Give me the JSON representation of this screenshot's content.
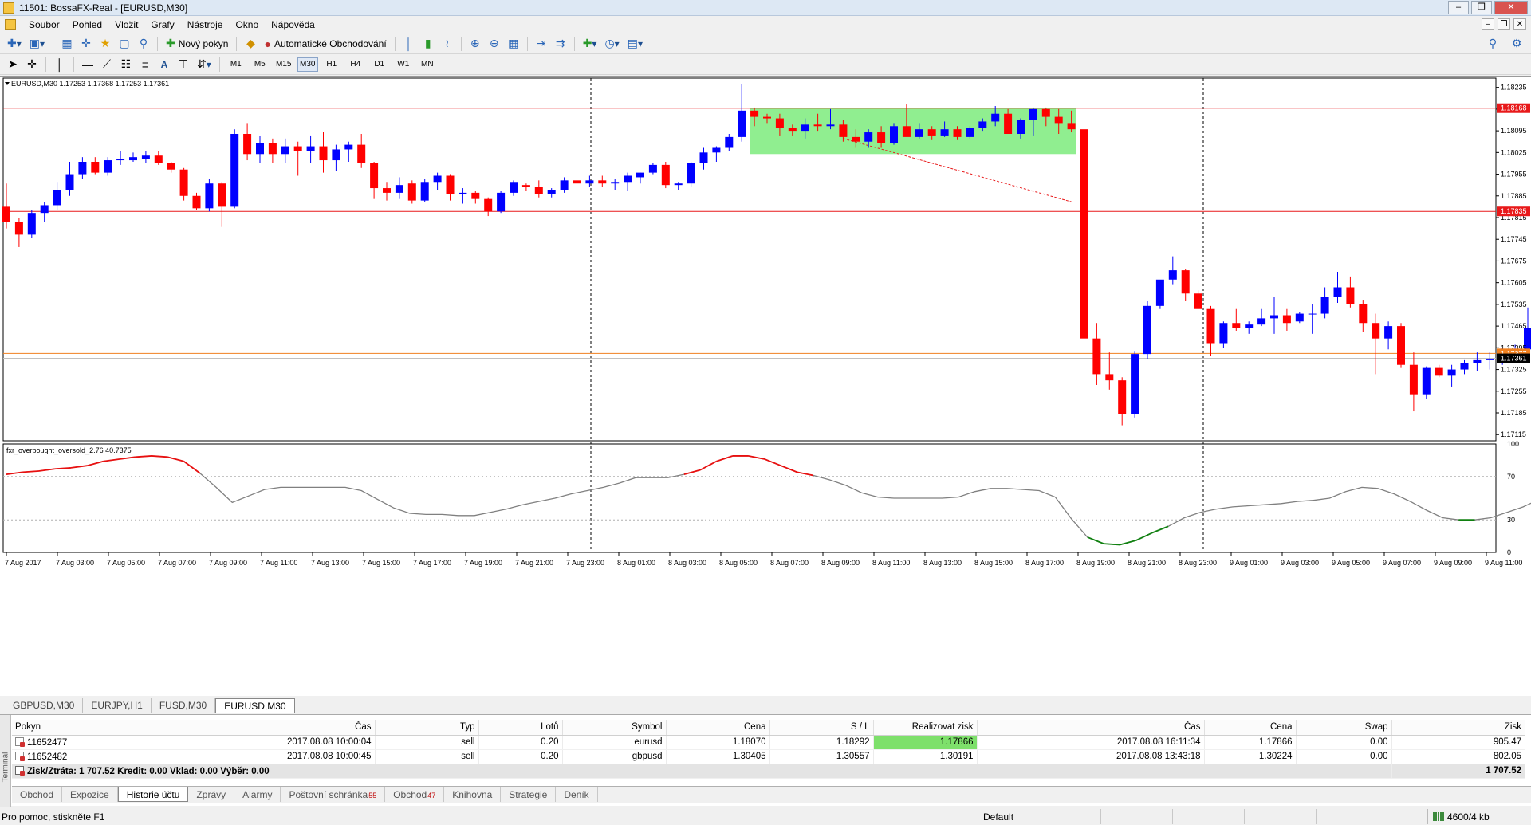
{
  "window": {
    "title": "11501: BossaFX-Real - [EURUSD,M30]"
  },
  "menu": [
    "Soubor",
    "Pohled",
    "Vložit",
    "Grafy",
    "Nástroje",
    "Okno",
    "Nápověda"
  ],
  "toolbar": {
    "new_order": "Nový pokyn",
    "auto_trading": "Automatické Obchodování"
  },
  "timeframes": [
    "M1",
    "M5",
    "M15",
    "M30",
    "H1",
    "H4",
    "D1",
    "W1",
    "MN"
  ],
  "active_timeframe": "M30",
  "chart": {
    "info": "EURUSD,M30  1.17253 1.17368 1.17253 1.17361",
    "indicator_label": "fxr_overbought_oversold_2.76 40.7375",
    "price_ticks": [
      "1.18235",
      "1.18165",
      "1.18095",
      "1.18025",
      "1.17955",
      "1.17885",
      "1.17815",
      "1.17745",
      "1.17675",
      "1.17605",
      "1.17535",
      "1.17465",
      "1.17395",
      "1.17325",
      "1.17255",
      "1.17185",
      "1.17115"
    ],
    "price_labels": {
      "upper_line": "1.18168",
      "lower_line": "1.17835",
      "orange_line": "1.17377",
      "bid": "1.17361"
    },
    "indicator_ticks": [
      "100",
      "70",
      "30",
      "0"
    ],
    "time_ticks": [
      "7 Aug 2017",
      "7 Aug 03:00",
      "7 Aug 05:00",
      "7 Aug 07:00",
      "7 Aug 09:00",
      "7 Aug 11:00",
      "7 Aug 13:00",
      "7 Aug 15:00",
      "7 Aug 17:00",
      "7 Aug 19:00",
      "7 Aug 21:00",
      "7 Aug 23:00",
      "8 Aug 01:00",
      "8 Aug 03:00",
      "8 Aug 05:00",
      "8 Aug 07:00",
      "8 Aug 09:00",
      "8 Aug 11:00",
      "8 Aug 13:00",
      "8 Aug 15:00",
      "8 Aug 17:00",
      "8 Aug 19:00",
      "8 Aug 21:00",
      "8 Aug 23:00",
      "9 Aug 01:00",
      "9 Aug 03:00",
      "9 Aug 05:00",
      "9 Aug 07:00",
      "9 Aug 09:00",
      "9 Aug 11:00"
    ],
    "colors": {
      "bull": "#0000ff",
      "bear": "#ff0000",
      "box": "#90ee90",
      "hline": "#e8191a",
      "orange": "#f08020",
      "osc": "#808080",
      "overbought": "#e81010",
      "oversold": "#108010"
    }
  },
  "chart_data": {
    "type": "candlestick",
    "symbol": "EURUSD",
    "timeframe": "M30",
    "ylim": [
      1.17095,
      1.18265
    ],
    "candles": [
      [
        1.1785,
        1.17925,
        1.1778,
        1.178
      ],
      [
        1.178,
        1.17815,
        1.1772,
        1.1776
      ],
      [
        1.1776,
        1.1784,
        1.1775,
        1.1783
      ],
      [
        1.1783,
        1.17865,
        1.178,
        1.17855
      ],
      [
        1.17855,
        1.1793,
        1.1784,
        1.17905
      ],
      [
        1.17905,
        1.17995,
        1.17885,
        1.17955
      ],
      [
        1.17955,
        1.1801,
        1.1794,
        1.17995
      ],
      [
        1.17995,
        1.1801,
        1.17955,
        1.1796
      ],
      [
        1.1796,
        1.1801,
        1.1795,
        1.18
      ],
      [
        1.18,
        1.1803,
        1.17985,
        1.18005
      ],
      [
        1.18,
        1.18025,
        1.17995,
        1.1801
      ],
      [
        1.18005,
        1.1803,
        1.1799,
        1.18015
      ],
      [
        1.18015,
        1.1803,
        1.17985,
        1.1799
      ],
      [
        1.1799,
        1.17995,
        1.1796,
        1.1797
      ],
      [
        1.1797,
        1.17975,
        1.1787,
        1.17885
      ],
      [
        1.17885,
        1.17895,
        1.1784,
        1.17845
      ],
      [
        1.17845,
        1.1794,
        1.17835,
        1.17925
      ],
      [
        1.17925,
        1.1793,
        1.17785,
        1.1785
      ],
      [
        1.1785,
        1.181,
        1.17845,
        1.18085
      ],
      [
        1.18085,
        1.1812,
        1.18,
        1.1802
      ],
      [
        1.1802,
        1.1808,
        1.1799,
        1.18055
      ],
      [
        1.18055,
        1.1807,
        1.1799,
        1.1802
      ],
      [
        1.1802,
        1.1807,
        1.1799,
        1.18045
      ],
      [
        1.18045,
        1.1806,
        1.1795,
        1.1803
      ],
      [
        1.1803,
        1.1808,
        1.1799,
        1.18045
      ],
      [
        1.18045,
        1.1809,
        1.1796,
        1.18
      ],
      [
        1.18,
        1.1805,
        1.17965,
        1.18035
      ],
      [
        1.18035,
        1.1806,
        1.17995,
        1.1805
      ],
      [
        1.1805,
        1.18085,
        1.17975,
        1.1799
      ],
      [
        1.1799,
        1.17995,
        1.17875,
        1.1791
      ],
      [
        1.1791,
        1.1793,
        1.1787,
        1.17895
      ],
      [
        1.17895,
        1.17945,
        1.17875,
        1.1792
      ],
      [
        1.17925,
        1.17935,
        1.1786,
        1.1787
      ],
      [
        1.1787,
        1.1794,
        1.17865,
        1.1793
      ],
      [
        1.1793,
        1.1796,
        1.17905,
        1.1795
      ],
      [
        1.1795,
        1.17955,
        1.1787,
        1.1789
      ],
      [
        1.1789,
        1.1791,
        1.1786,
        1.17895
      ],
      [
        1.17895,
        1.179,
        1.1786,
        1.17875
      ],
      [
        1.17875,
        1.1788,
        1.1782,
        1.17835
      ],
      [
        1.17835,
        1.179,
        1.1783,
        1.17895
      ],
      [
        1.17895,
        1.17935,
        1.17885,
        1.1793
      ],
      [
        1.1792,
        1.17925,
        1.179,
        1.17915
      ],
      [
        1.17915,
        1.17935,
        1.1788,
        1.1789
      ],
      [
        1.1789,
        1.1791,
        1.1788,
        1.17905
      ],
      [
        1.17905,
        1.17945,
        1.17895,
        1.17935
      ],
      [
        1.17935,
        1.17955,
        1.17905,
        1.17925
      ],
      [
        1.17925,
        1.1795,
        1.17915,
        1.17935
      ],
      [
        1.17935,
        1.1795,
        1.17915,
        1.17925
      ],
      [
        1.17925,
        1.1794,
        1.17905,
        1.1793
      ],
      [
        1.1793,
        1.1796,
        1.179,
        1.1795
      ],
      [
        1.17945,
        1.1796,
        1.17925,
        1.1796
      ],
      [
        1.1796,
        1.1799,
        1.17955,
        1.17985
      ],
      [
        1.17985,
        1.17995,
        1.1791,
        1.1792
      ],
      [
        1.1792,
        1.1793,
        1.17905,
        1.17925
      ],
      [
        1.17925,
        1.17995,
        1.17915,
        1.1799
      ],
      [
        1.1799,
        1.1804,
        1.1797,
        1.18025
      ],
      [
        1.18025,
        1.18045,
        1.17995,
        1.1804
      ],
      [
        1.1804,
        1.18085,
        1.1803,
        1.18075
      ],
      [
        1.18075,
        1.18245,
        1.1806,
        1.1816
      ],
      [
        1.1816,
        1.1817,
        1.1811,
        1.1814
      ],
      [
        1.1814,
        1.1815,
        1.1812,
        1.18135
      ],
      [
        1.18135,
        1.1815,
        1.1808,
        1.18105
      ],
      [
        1.18105,
        1.18115,
        1.1808,
        1.18095
      ],
      [
        1.18095,
        1.18135,
        1.1807,
        1.18115
      ],
      [
        1.18115,
        1.1815,
        1.18095,
        1.1811
      ],
      [
        1.1811,
        1.18165,
        1.181,
        1.18115
      ],
      [
        1.18115,
        1.1813,
        1.1806,
        1.18075
      ],
      [
        1.18075,
        1.181,
        1.1804,
        1.1806
      ],
      [
        1.1806,
        1.181,
        1.1804,
        1.1809
      ],
      [
        1.1809,
        1.1811,
        1.1804,
        1.18055
      ],
      [
        1.18055,
        1.1812,
        1.1805,
        1.1811
      ],
      [
        1.1811,
        1.1818,
        1.18085,
        1.18075
      ],
      [
        1.18075,
        1.1812,
        1.1807,
        1.181
      ],
      [
        1.181,
        1.1811,
        1.18065,
        1.1808
      ],
      [
        1.1808,
        1.18125,
        1.18075,
        1.181
      ],
      [
        1.181,
        1.1811,
        1.18065,
        1.18075
      ],
      [
        1.18075,
        1.1811,
        1.1807,
        1.18105
      ],
      [
        1.18105,
        1.18135,
        1.18095,
        1.18125
      ],
      [
        1.18125,
        1.18175,
        1.1811,
        1.1815
      ],
      [
        1.1815,
        1.18165,
        1.1809,
        1.18085
      ],
      [
        1.18085,
        1.18135,
        1.1807,
        1.1813
      ],
      [
        1.1813,
        1.1817,
        1.1808,
        1.18165
      ],
      [
        1.18165,
        1.1817,
        1.1811,
        1.1814
      ],
      [
        1.1814,
        1.18165,
        1.18085,
        1.1812
      ],
      [
        1.1812,
        1.1816,
        1.1809,
        1.181
      ],
      [
        1.181,
        1.1811,
        1.174,
        1.17425
      ],
      [
        1.17425,
        1.17475,
        1.17275,
        1.1731
      ],
      [
        1.1731,
        1.1738,
        1.1726,
        1.1729
      ],
      [
        1.1729,
        1.173,
        1.17145,
        1.1718
      ],
      [
        1.1718,
        1.17385,
        1.1717,
        1.17375
      ],
      [
        1.17375,
        1.17545,
        1.1736,
        1.1753
      ],
      [
        1.1753,
        1.1761,
        1.1752,
        1.17615
      ],
      [
        1.17615,
        1.1769,
        1.176,
        1.17645
      ],
      [
        1.17645,
        1.1765,
        1.17545,
        1.1757
      ],
      [
        1.1757,
        1.1758,
        1.1752,
        1.1752
      ],
      [
        1.1752,
        1.1753,
        1.1737,
        1.1741
      ],
      [
        1.1741,
        1.1748,
        1.17395,
        1.17475
      ],
      [
        1.17475,
        1.1752,
        1.1745,
        1.1746
      ],
      [
        1.1746,
        1.1748,
        1.1744,
        1.1747
      ],
      [
        1.1747,
        1.1752,
        1.17465,
        1.1749
      ],
      [
        1.1749,
        1.1756,
        1.1744,
        1.175
      ],
      [
        1.175,
        1.1752,
        1.1745,
        1.17475
      ],
      [
        1.1748,
        1.1751,
        1.17475,
        1.17505
      ],
      [
        1.17505,
        1.17535,
        1.1744,
        1.17505
      ],
      [
        1.17505,
        1.1759,
        1.1749,
        1.1756
      ],
      [
        1.1756,
        1.1764,
        1.1754,
        1.1759
      ],
      [
        1.1759,
        1.17625,
        1.17525,
        1.17535
      ],
      [
        1.17535,
        1.1755,
        1.17445,
        1.17475
      ],
      [
        1.17475,
        1.17505,
        1.1731,
        1.17425
      ],
      [
        1.17425,
        1.1748,
        1.1739,
        1.17465
      ],
      [
        1.17465,
        1.17475,
        1.1733,
        1.1734
      ],
      [
        1.1734,
        1.1738,
        1.1719,
        1.17245
      ],
      [
        1.17245,
        1.17335,
        1.1723,
        1.1733
      ],
      [
        1.1733,
        1.1734,
        1.173,
        1.17305
      ],
      [
        1.17305,
        1.1734,
        1.1727,
        1.17325
      ],
      [
        1.17325,
        1.17355,
        1.1731,
        1.17345
      ],
      [
        1.17345,
        1.1738,
        1.1732,
        1.17355
      ],
      [
        1.17355,
        1.1738,
        1.17325,
        1.1736
      ],
      [
        1.1736,
        1.17395,
        1.1734,
        1.17375
      ],
      [
        1.17375,
        1.17405,
        1.17345,
        1.1739
      ],
      [
        1.1739,
        1.17525,
        1.17375,
        1.1746
      ],
      [
        1.1746,
        1.1751,
        1.17425,
        1.17445
      ],
      [
        1.17445,
        1.17615,
        1.1743,
        1.1747
      ],
      [
        1.1747,
        1.17525,
        1.1735,
        1.17405
      ],
      [
        1.17405,
        1.1741,
        1.1725,
        1.17265
      ],
      [
        1.17265,
        1.1732,
        1.17225,
        1.1731
      ],
      [
        1.1731,
        1.1746,
        1.1729,
        1.17395
      ]
    ],
    "price_lines": {
      "upper": 1.18168,
      "lower": 1.17835,
      "orange": 1.17377,
      "bid": 1.17361
    },
    "rectangle": {
      "from_bar": 59,
      "to_bar": 84,
      "high": 1.18168,
      "low": 1.1802
    },
    "indicator": {
      "name": "fxr_overbought_oversold_2.76",
      "value": 40.7375,
      "levels": [
        70,
        30
      ],
      "ylim": [
        0,
        100
      ],
      "values": [
        72,
        74,
        75,
        77,
        78,
        80,
        84,
        86,
        88,
        89,
        88,
        84,
        73,
        60,
        46,
        52,
        58,
        60,
        60,
        60,
        60,
        60,
        57,
        49,
        41,
        36,
        35,
        35,
        34,
        34,
        37,
        40,
        44,
        47,
        50,
        54,
        57,
        60,
        64,
        69,
        69,
        69,
        72,
        76,
        84,
        89,
        89,
        86,
        80,
        74,
        71,
        67,
        62,
        55,
        51,
        50,
        50,
        50,
        50,
        51,
        56,
        59,
        59,
        58,
        57,
        51,
        31,
        14,
        8,
        7,
        11,
        18,
        24,
        32,
        37,
        40,
        42,
        43,
        44,
        45,
        47,
        48,
        50,
        56,
        60,
        59,
        54,
        47,
        39,
        32,
        30,
        30,
        32,
        37,
        42,
        49,
        57,
        62,
        58,
        52
      ]
    }
  },
  "chart_tabs": [
    "GBPUSD,M30",
    "EURJPY,H1",
    "FUSD,M30",
    "EURUSD,M30"
  ],
  "active_chart_tab": "EURUSD,M30",
  "terminal": {
    "side_label": "Terminál",
    "columns": [
      "Pokyn",
      "Čas",
      "Typ",
      "Lotů",
      "Symbol",
      "Cena",
      "S / L",
      "Realizovat zisk",
      "Čas",
      "Cena",
      "Swap",
      "Zisk"
    ],
    "rows": [
      [
        "11652477",
        "2017.08.08 10:00:04",
        "sell",
        "0.20",
        "eurusd",
        "1.18070",
        "1.18292",
        "1.17866",
        "2017.08.08 16:11:34",
        "1.17866",
        "0.00",
        "905.47"
      ],
      [
        "11652482",
        "2017.08.08 10:00:45",
        "sell",
        "0.20",
        "gbpusd",
        "1.30405",
        "1.30557",
        "1.30191",
        "2017.08.08 13:43:18",
        "1.30224",
        "0.00",
        "802.05"
      ]
    ],
    "summary": "Zisk/Ztráta: 1 707.52  Kredit: 0.00  Vklad: 0.00  Výběr: 0.00",
    "summary_total": "1 707.52",
    "tabs": [
      {
        "label": "Obchod",
        "badge": ""
      },
      {
        "label": "Expozice",
        "badge": ""
      },
      {
        "label": "Historie účtu",
        "badge": ""
      },
      {
        "label": "Zprávy",
        "badge": ""
      },
      {
        "label": "Alarmy",
        "badge": ""
      },
      {
        "label": "Poštovní schránka",
        "badge": "55"
      },
      {
        "label": "Obchod",
        "badge": "47"
      },
      {
        "label": "Knihovna",
        "badge": ""
      },
      {
        "label": "Strategie",
        "badge": ""
      },
      {
        "label": "Deník",
        "badge": ""
      }
    ],
    "active_tab": "Historie účtu"
  },
  "status": {
    "help": "Pro pomoc, stiskněte F1",
    "profile": "Default",
    "traffic": "4600/4 kb"
  }
}
